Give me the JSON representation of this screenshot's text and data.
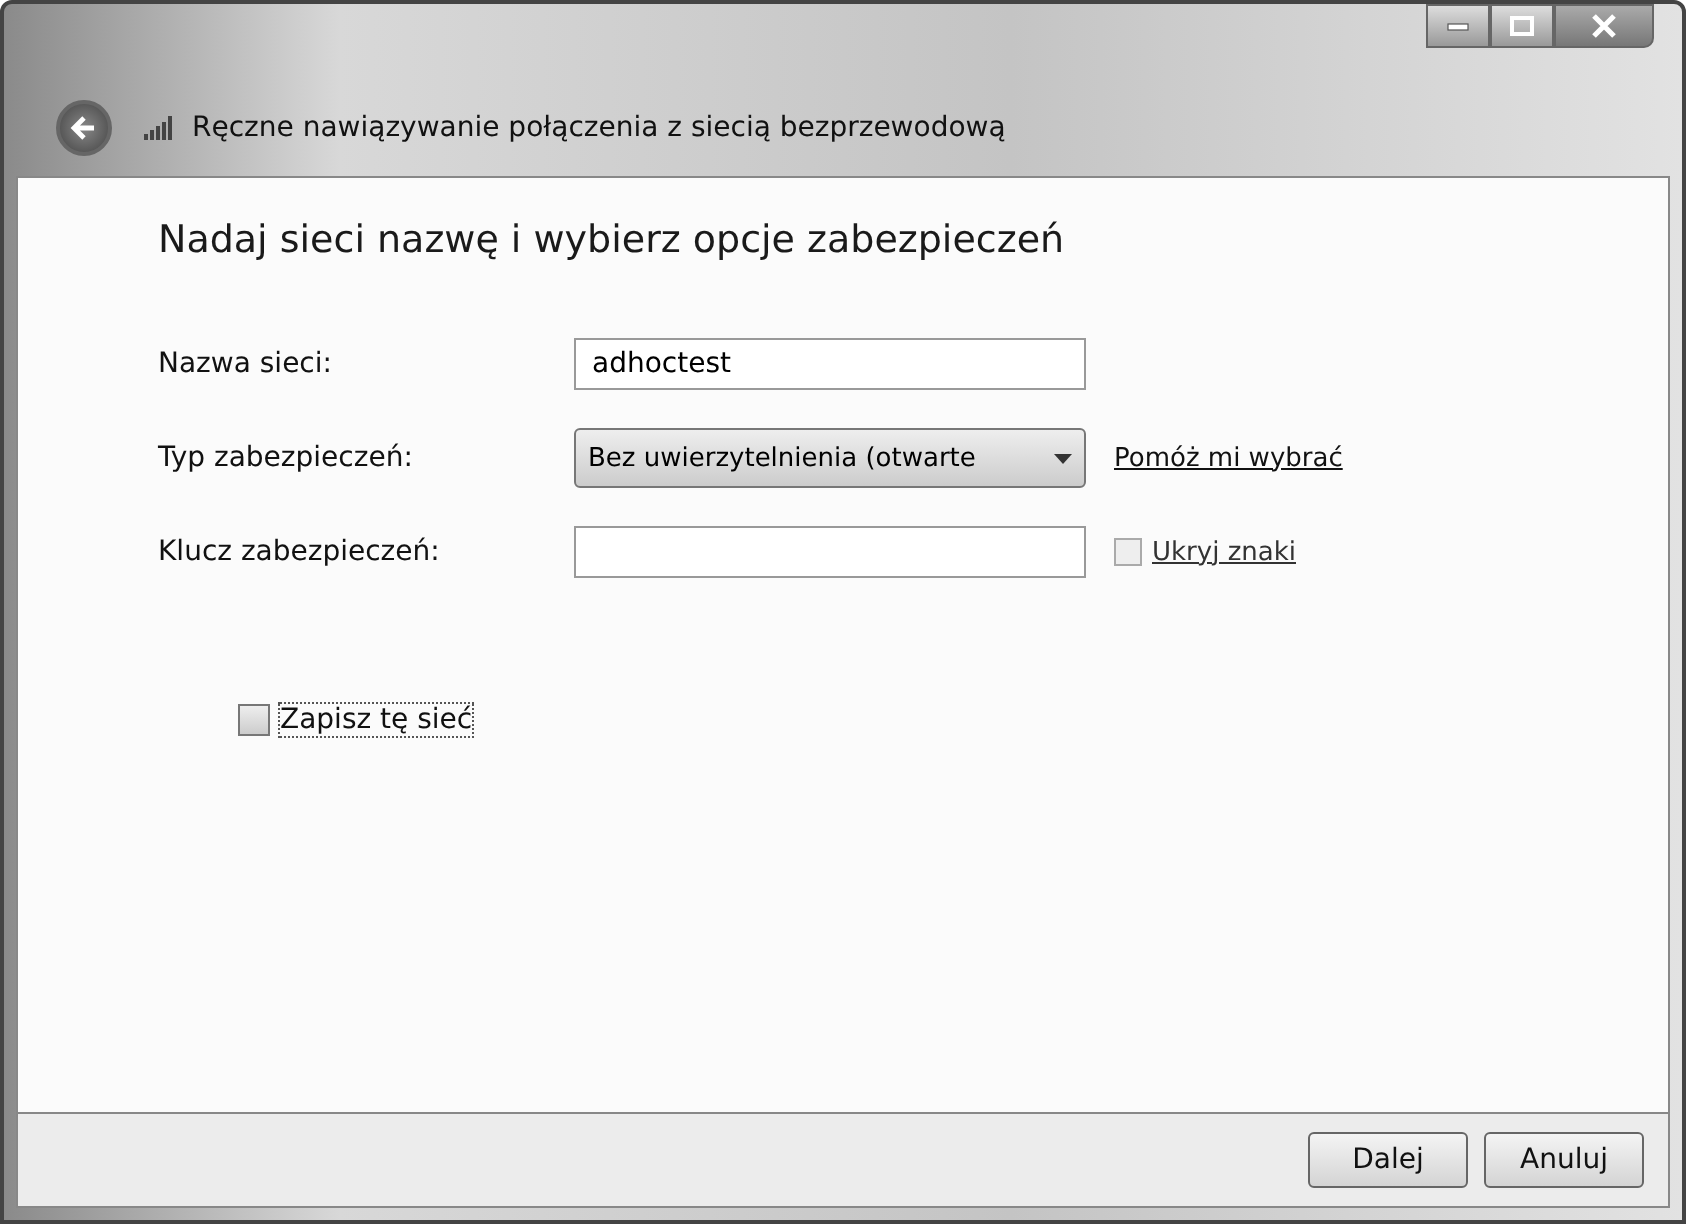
{
  "window": {
    "title": "Ręczne nawiązywanie połączenia z siecią bezprzewodową"
  },
  "heading": "Nadaj sieci nazwę i wybierz opcje zabezpieczeń",
  "fields": [
    {
      "kind": "text",
      "label": "Nazwa sieci:",
      "value": "adhoctest"
    },
    {
      "kind": "dropdown",
      "label": "Typ zabezpieczeń:",
      "value": "Bez uwierzytelnienia (otwarte",
      "link": "Pomóż mi wybrać"
    },
    {
      "kind": "password",
      "label": "Klucz zabezpieczeń:",
      "checkbox": {
        "label": "Ukryj znaki",
        "checked": false,
        "disabled": true
      }
    }
  ],
  "save": {
    "label": "Zapisz tę sieć",
    "checked": false
  },
  "buttons": [
    "Dalej",
    "Anuluj"
  ]
}
